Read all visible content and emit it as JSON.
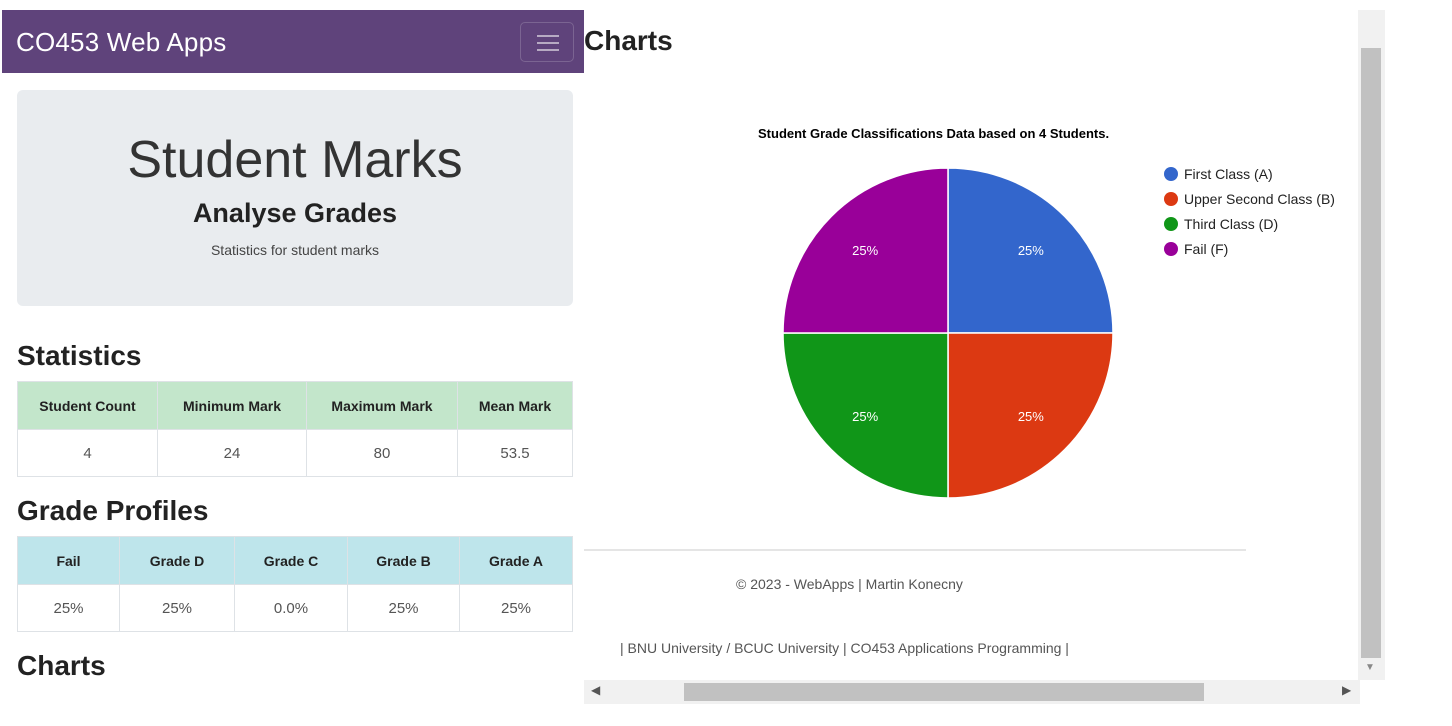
{
  "navbar": {
    "brand": "CO453 Web Apps",
    "menu_icon": "hamburger-icon"
  },
  "jumbotron": {
    "title": "Student Marks",
    "subtitle": "Analyse Grades",
    "description": "Statistics for student marks"
  },
  "statistics": {
    "heading": "Statistics",
    "headers": [
      "Student Count",
      "Minimum Mark",
      "Maximum Mark",
      "Mean Mark"
    ],
    "values": [
      "4",
      "24",
      "80",
      "53.5"
    ]
  },
  "grade_profiles": {
    "heading": "Grade Profiles",
    "headers": [
      "Fail",
      "Grade D",
      "Grade C",
      "Grade B",
      "Grade A"
    ],
    "values": [
      "25%",
      "25%",
      "0.0%",
      "25%",
      "25%"
    ]
  },
  "charts_heading_left": "Charts",
  "charts_heading_right": "Charts",
  "chart_data": {
    "type": "pie",
    "title": "Student Grade Classifications Data based on 4 Students.",
    "series": [
      {
        "name": "First Class (A)",
        "value": 25,
        "label": "25%",
        "color": "#3366cc"
      },
      {
        "name": "Upper Second Class (B)",
        "value": 25,
        "label": "25%",
        "color": "#dc3912"
      },
      {
        "name": "Third Class (D)",
        "value": 25,
        "label": "25%",
        "color": "#109618"
      },
      {
        "name": "Fail (F)",
        "value": 25,
        "label": "25%",
        "color": "#990099"
      }
    ],
    "legend": "right"
  },
  "footer": {
    "copyright": "© 2023 - WebApps | Martin Konecny",
    "links": "| BNU University / BCUC University | CO453 Applications Programming |"
  }
}
